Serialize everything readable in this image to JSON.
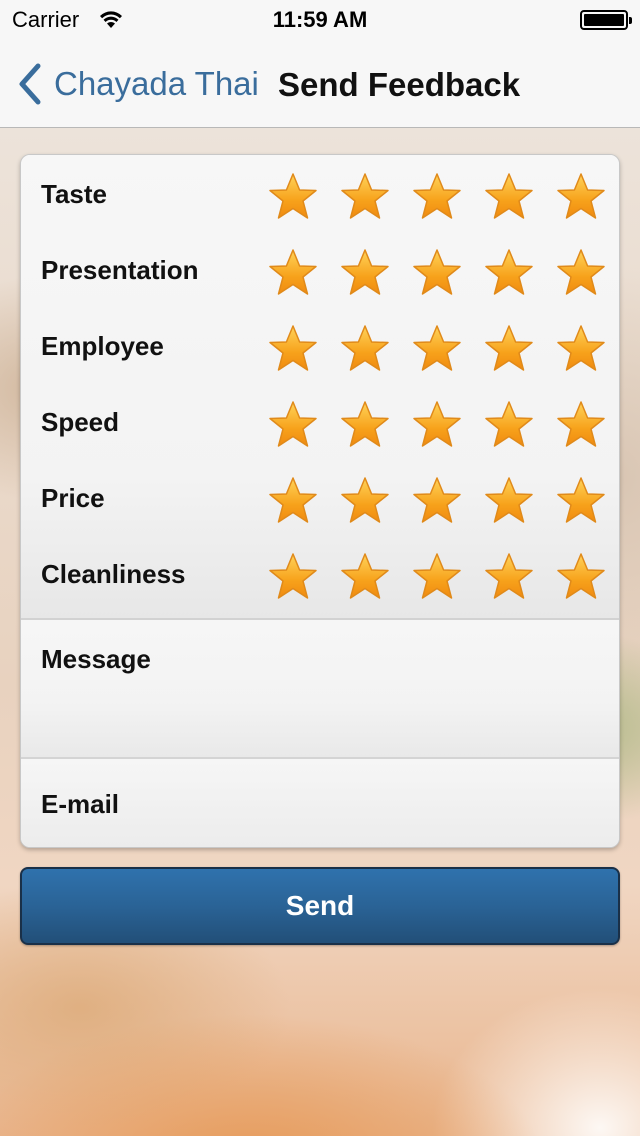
{
  "status_bar": {
    "carrier": "Carrier",
    "time": "11:59 AM"
  },
  "nav": {
    "back_label": "Chayada Thai",
    "title": "Send Feedback"
  },
  "ratings": [
    {
      "label": "Taste",
      "stars": 5,
      "max": 5
    },
    {
      "label": "Presentation",
      "stars": 5,
      "max": 5
    },
    {
      "label": "Employee",
      "stars": 5,
      "max": 5
    },
    {
      "label": "Speed",
      "stars": 5,
      "max": 5
    },
    {
      "label": "Price",
      "stars": 5,
      "max": 5
    },
    {
      "label": "Cleanliness",
      "stars": 5,
      "max": 5
    }
  ],
  "message": {
    "label": "Message",
    "value": ""
  },
  "email": {
    "label": "E-mail",
    "value": ""
  },
  "send_label": "Send",
  "colors": {
    "accent": "#3a6d9c",
    "button": "#2a6396",
    "star": "#f7a21b"
  }
}
